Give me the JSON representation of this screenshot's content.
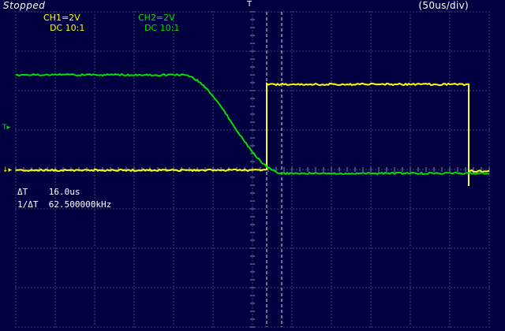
{
  "status": "Stopped",
  "timebase": "(50us/div)",
  "channels": {
    "ch1": {
      "label": "CH1=2V",
      "coupling": "DC  10:1",
      "color": "#ffff00"
    },
    "ch2": {
      "label": "CH2=2V",
      "coupling": "DC  10:1",
      "color": "#00e000"
    }
  },
  "measurements": {
    "delta_t_label": "ΔT",
    "delta_t_value": "16.0us",
    "inv_delta_t_label": "1/ΔT",
    "inv_delta_t_value": "62.500000kHz"
  },
  "markers": {
    "trigger_level": "T▸",
    "ground_ref": "↓▸",
    "trigger_position": "T"
  },
  "colors": {
    "background": "#000040",
    "grid": "#8a8aa8",
    "cursor": "#e0e0e0"
  }
}
